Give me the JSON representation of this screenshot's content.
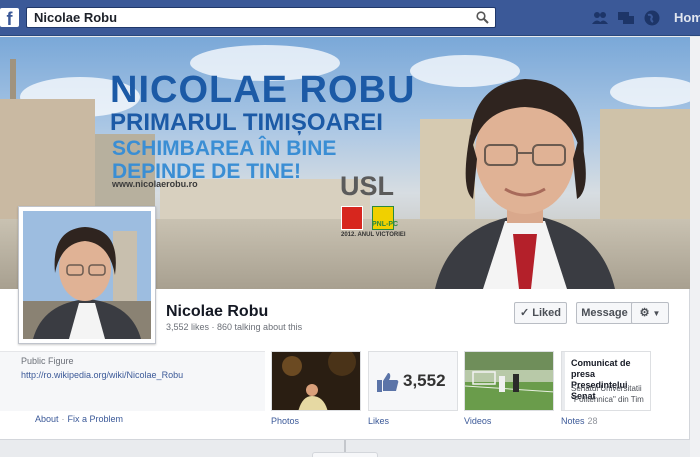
{
  "search": {
    "value": "Nicolae Robu"
  },
  "nav": {
    "home_label": "Home"
  },
  "cover": {
    "title": "NICOLAE ROBU",
    "subtitle": "PRIMARUL TIMIȘOAREI",
    "slogan": "SCHIMBAREA ÎN BINE DEPINDE DE TINE!",
    "party": "USL",
    "party_logos": [
      "PSD",
      "PNL-PC"
    ],
    "url": "www.nicolaerobu.ro",
    "year_text": "2012. ANUL VICTORIEI"
  },
  "profile": {
    "name": "Nicolae Robu",
    "stats": "3,552 likes · 860 talking about this"
  },
  "actions": {
    "liked_label": "Liked",
    "message_label": "Message"
  },
  "about": {
    "category": "Public Figure",
    "link": "http://ro.wikipedia.org/wiki/Nicolae_Robu",
    "footer_about": "About",
    "footer_separator": "·",
    "footer_fix": "Fix a Problem"
  },
  "tiles": {
    "photos_label": "Photos",
    "likes_label": "Likes",
    "likes_count": "3,552",
    "videos_label": "Videos",
    "notes_label": "Notes",
    "notes_count": "28",
    "note_title": "Comunicat de presa Presedintelui Senat",
    "note_body": "Senatul Universitatii \"Politehnica\" din Tim"
  },
  "colors": {
    "facebook_blue": "#3b5998",
    "cover_title_blue": "#1c5aa6",
    "slogan_blue": "#3a8ed4",
    "psd_red": "#d7261e"
  }
}
